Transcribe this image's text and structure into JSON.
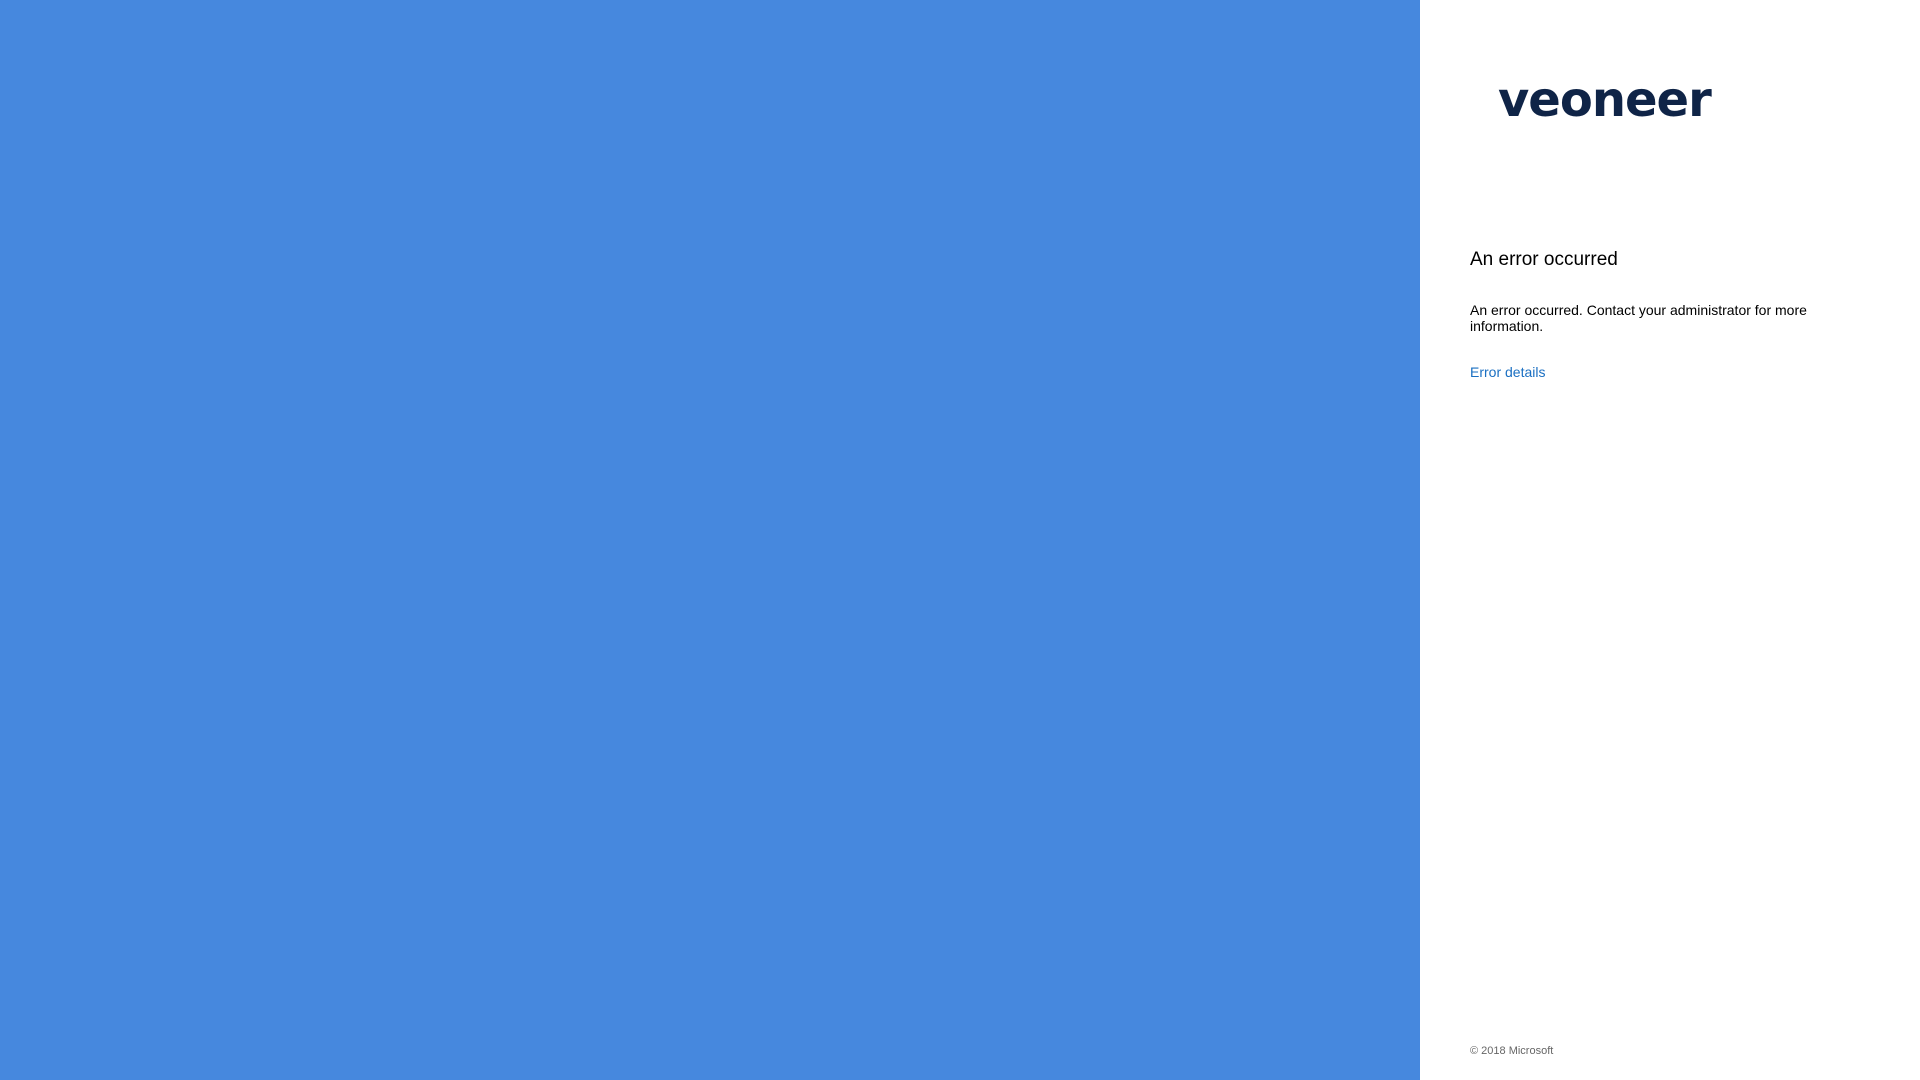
{
  "logo": {
    "text": "veoneer",
    "color": "#0f2447"
  },
  "error": {
    "title": "An error occurred",
    "message": "An error occurred. Contact your administrator for more information.",
    "details_link": "Error details"
  },
  "footer": {
    "copyright": "© 2018 Microsoft"
  },
  "colors": {
    "illustration_background": "#4688de",
    "panel_background": "#ffffff",
    "link": "#1a6fc2"
  }
}
